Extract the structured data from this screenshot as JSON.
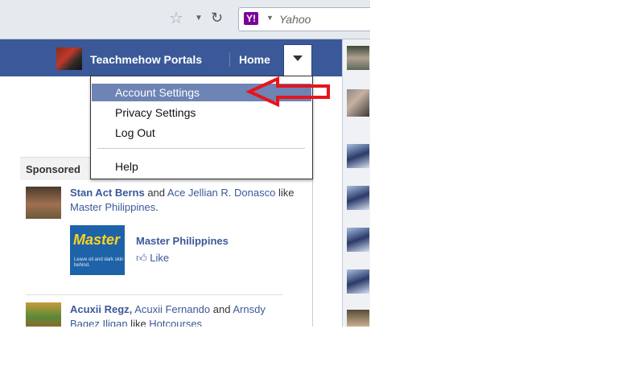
{
  "browser": {
    "search_placeholder": "Yahoo",
    "search_engine_logo": "Y!",
    "icons": [
      "star-icon",
      "dropdown-icon",
      "reload-icon"
    ]
  },
  "topbar": {
    "profile_name": "Teachmehow Portals",
    "home_label": "Home",
    "bar_color": "#3b5998"
  },
  "menu": {
    "items": [
      {
        "label": "Account Settings",
        "highlighted": true
      },
      {
        "label": "Privacy Settings",
        "highlighted": false
      },
      {
        "label": "Log Out",
        "highlighted": false
      },
      {
        "label": "Help",
        "highlighted": false
      }
    ],
    "highlight_color": "#6d84b4"
  },
  "sidebar": {
    "sponsored_heading": "Sponsored"
  },
  "ad1": {
    "person1": "Stan Act Berns",
    "and_text": " and ",
    "person2": "Ace Jellian R. Donasco",
    "like_text": " like ",
    "page": "Master Philippines",
    "period": ".",
    "image_title": "Master",
    "image_caption": "Leave oil and dark skin behind.",
    "page_title": "Master Philippines",
    "like_label": "Like"
  },
  "ad2": {
    "person1": "Acuxii Regz,",
    "person2": "Acuxii Fernando",
    "and_text": " and ",
    "person3": "Arnsdy Baqez Iligan",
    "like_text": " like ",
    "page": "Hotcourses"
  },
  "annotation": {
    "color": "#e8141c"
  }
}
